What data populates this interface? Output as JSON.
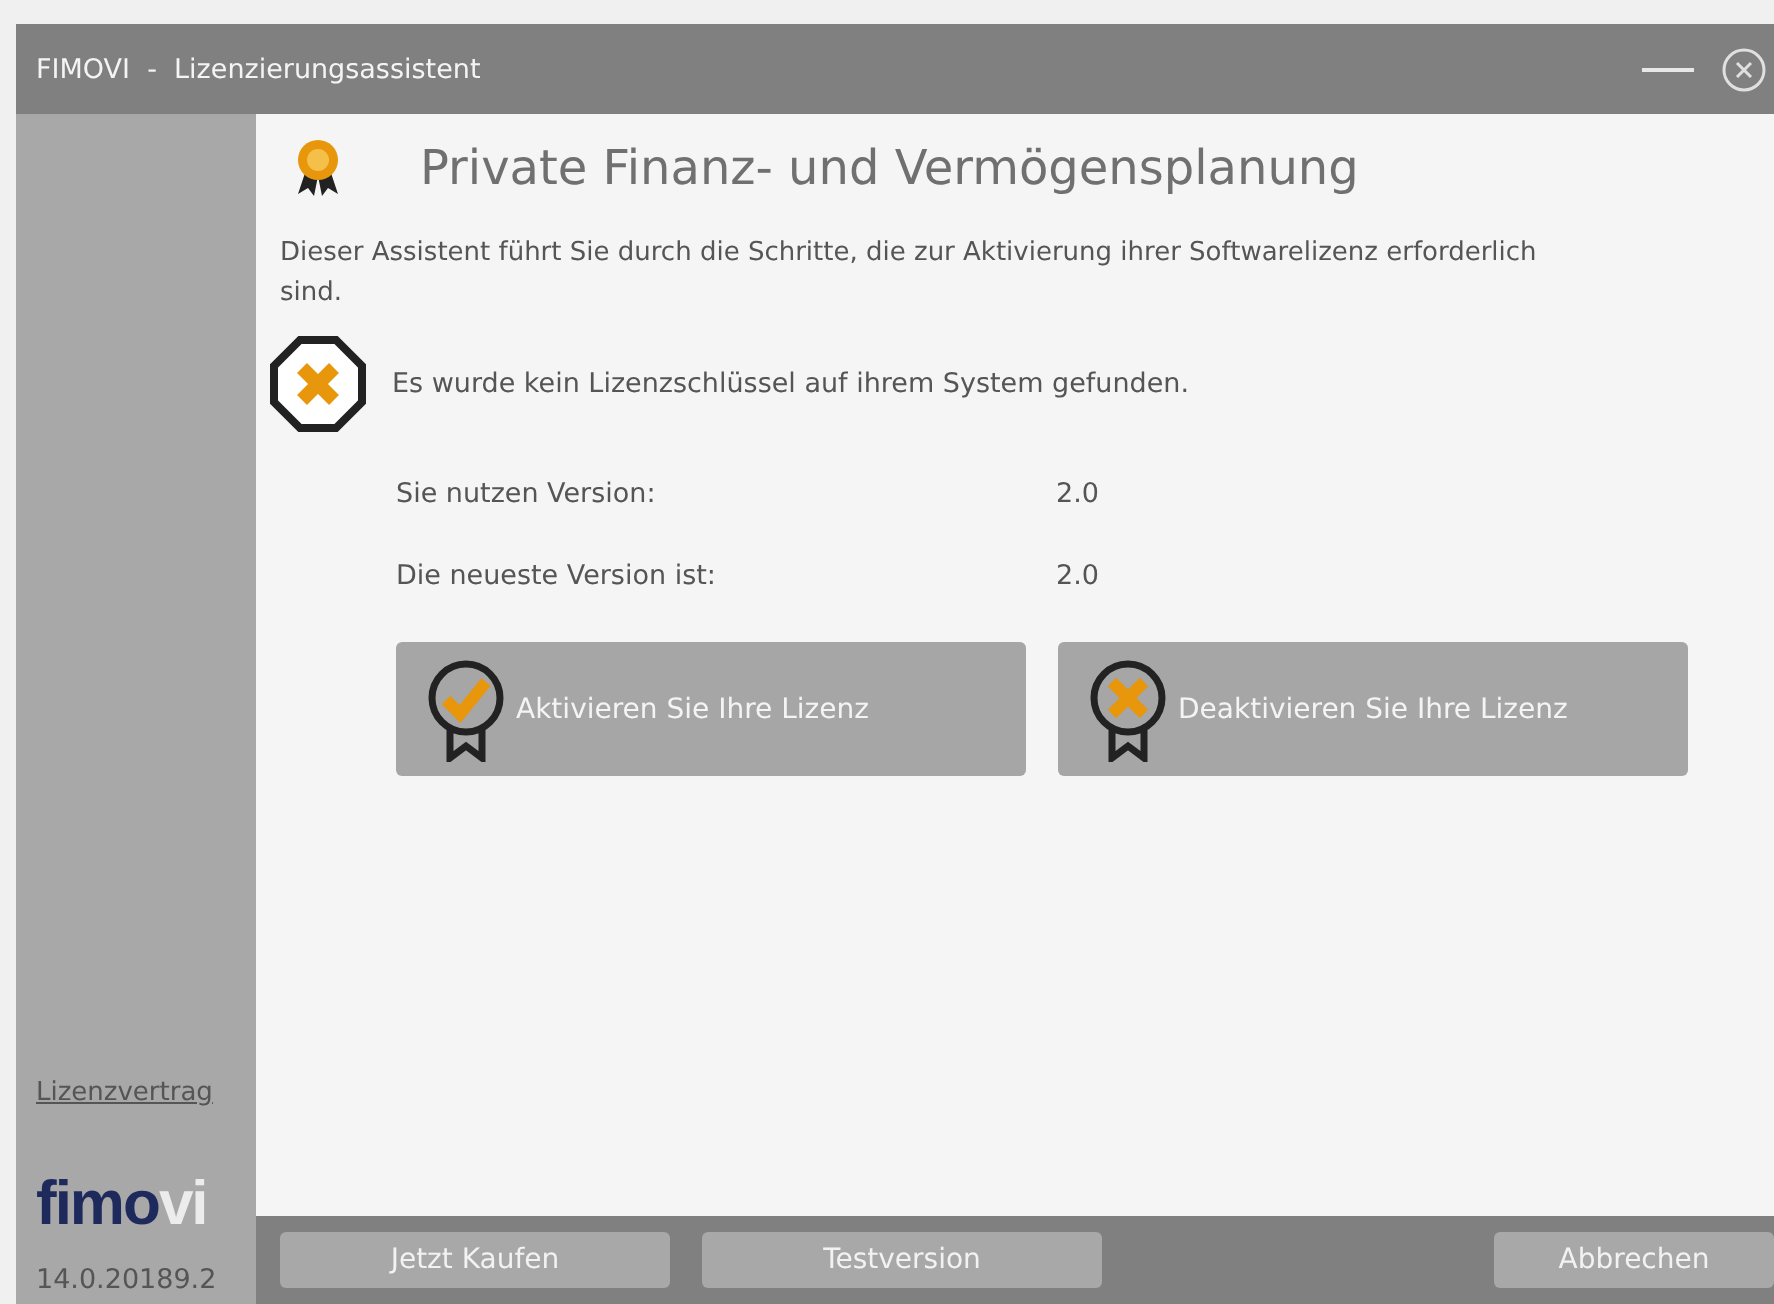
{
  "window": {
    "title": "FIMOVI  -  Lizenzierungsassistent"
  },
  "sidebar": {
    "link": "Lizenzvertrag",
    "logo": {
      "strong": "fimo",
      "faded": "vi"
    },
    "version": "14.0.20189.2"
  },
  "heading": "Private Finanz- und Vermögensplanung",
  "intro": "Dieser Assistent führt Sie durch die Schritte, die zur Aktivierung ihrer Softwarelizenz erforderlich sind.",
  "alert": {
    "kind": "error",
    "message": "Es wurde kein Lizenzschlüssel auf ihrem System gefunden."
  },
  "versions": [
    {
      "label": "Sie nutzen Version:",
      "value": "2.0"
    },
    {
      "label": "Die neueste Version ist:",
      "value": "2.0"
    }
  ],
  "actions": [
    {
      "kind": "activate",
      "label": "Aktivieren Sie Ihre Lizenz"
    },
    {
      "kind": "deactivate",
      "label": "Deaktivieren Sie Ihre Lizenz"
    }
  ],
  "footer_buttons": [
    {
      "label": "Jetzt Kaufen",
      "kind": "action"
    },
    {
      "label": "Testversion",
      "kind": "action"
    },
    {
      "label": "Abbrechen",
      "kind": "cancel"
    }
  ]
}
